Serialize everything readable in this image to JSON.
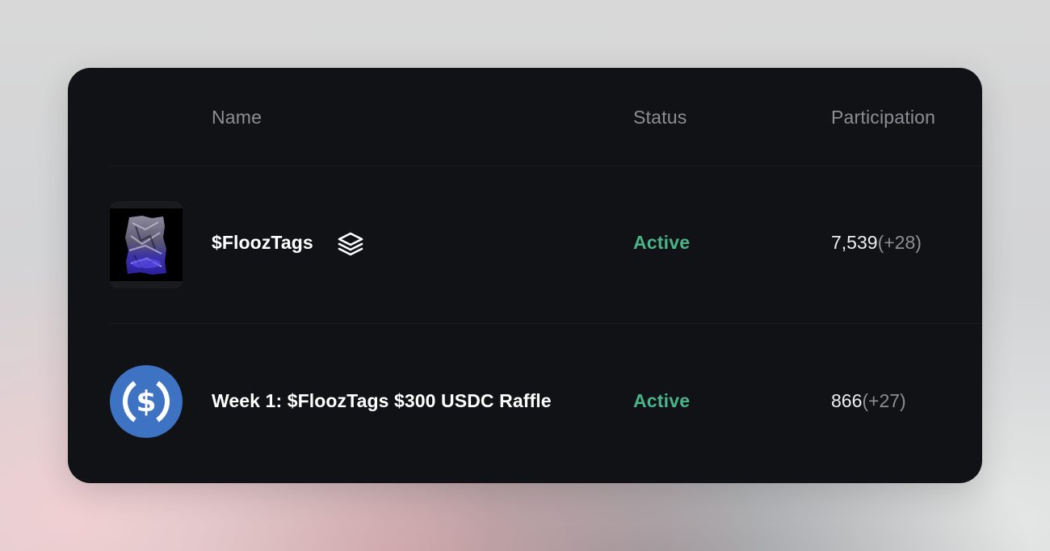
{
  "table": {
    "columns": {
      "name": "Name",
      "status": "Status",
      "participation": "Participation"
    },
    "rows": [
      {
        "name": "$FloozTags",
        "status": "Active",
        "participation": "7,539",
        "participation_delta": "(+28)",
        "icon": "layers-stack-icon"
      },
      {
        "name": "Week 1: $FloozTags $300 USDC Raffle",
        "status": "Active",
        "participation": "866",
        "participation_delta": "(+27)",
        "icon": "usdc-coin-icon"
      }
    ]
  },
  "colors": {
    "card_bg": "#111215",
    "status_active": "#4bb38a",
    "header_text": "#8b8e95",
    "usdc_blue": "#3e73c4"
  }
}
